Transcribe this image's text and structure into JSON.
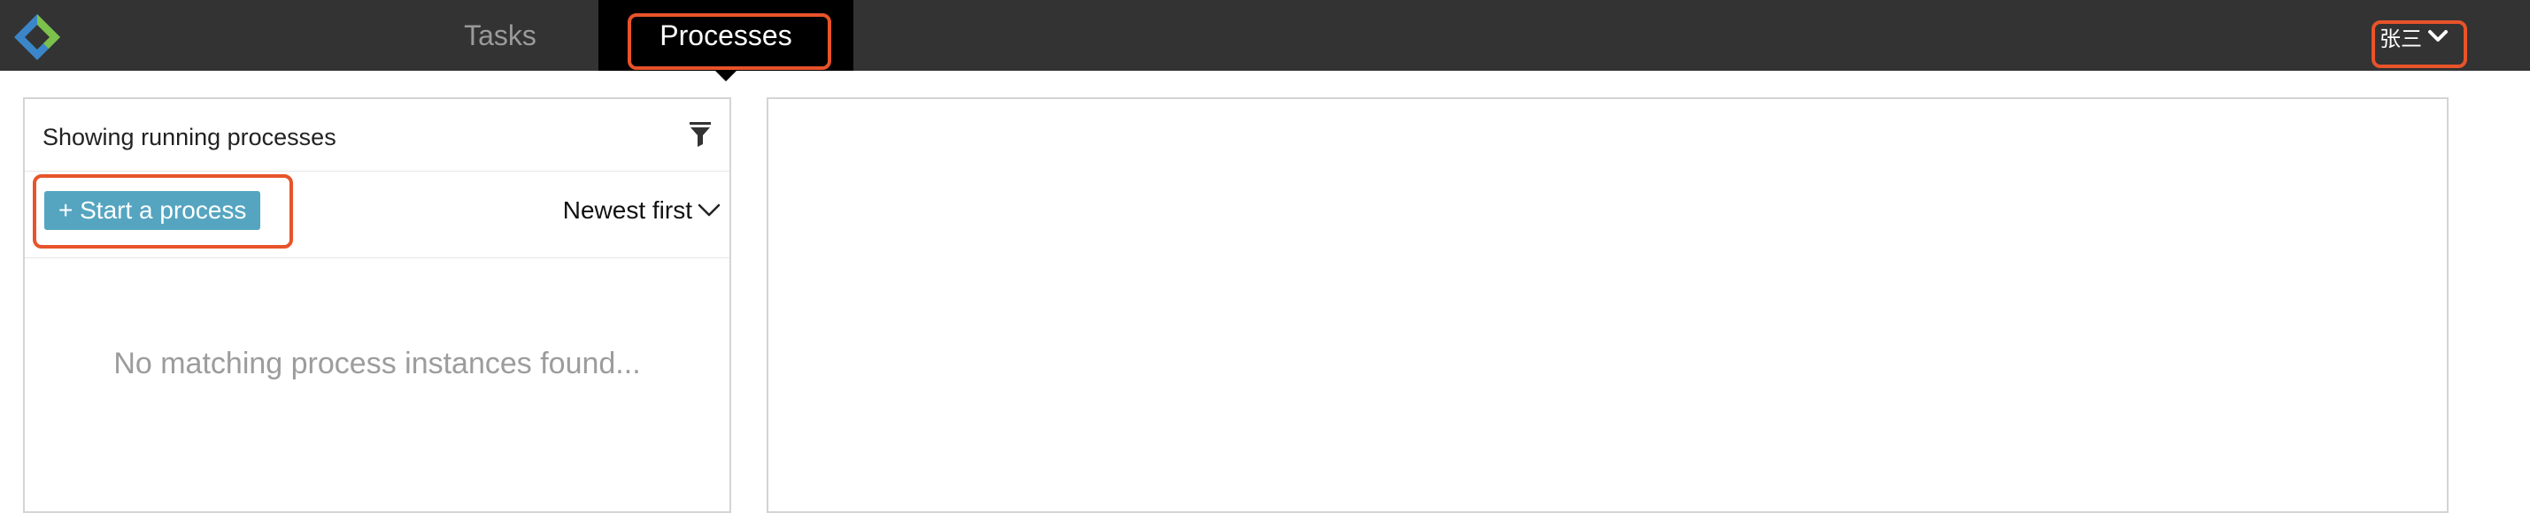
{
  "app": {
    "logo_icon": "diamond-logo-icon",
    "colors": {
      "navbar": "#333333",
      "active_tab": "#000000",
      "accent_button": "#55a5c1",
      "highlight": "#e8532a"
    }
  },
  "nav": {
    "tabs": [
      {
        "label": "Tasks",
        "active": false
      },
      {
        "label": "Processes",
        "active": true
      }
    ],
    "user": {
      "name": "张三",
      "icon": "chevron-down-icon"
    }
  },
  "left_panel": {
    "title": "Showing running processes",
    "filter_icon": "filter-icon",
    "start_button": "+ Start a process",
    "sort": {
      "selected": "Newest first",
      "icon": "chevron-down-icon"
    },
    "empty_message": "No matching process instances found..."
  },
  "right_panel": {}
}
